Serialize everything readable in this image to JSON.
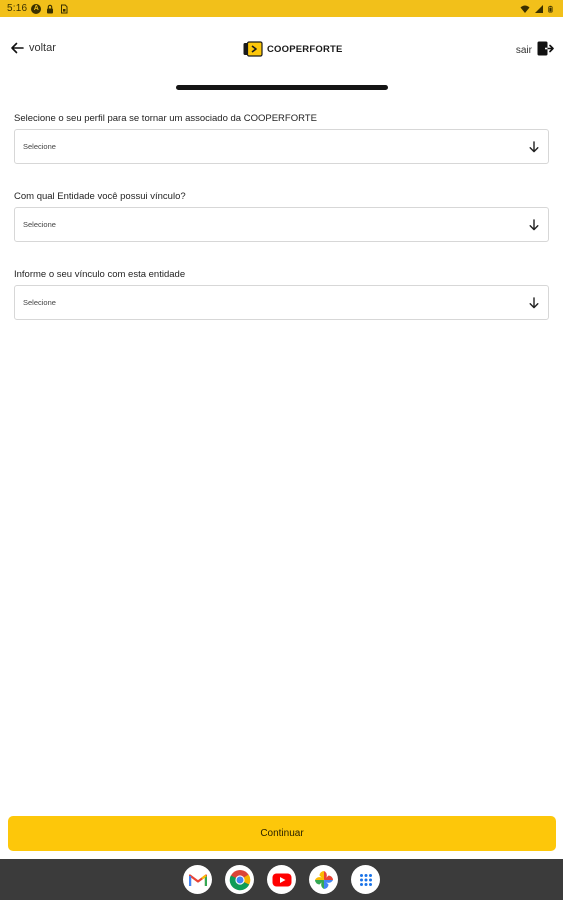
{
  "status_bar": {
    "time": "5:16",
    "badge_glyph": "A"
  },
  "header": {
    "back_label": "voltar",
    "logo_text": "COOPERFORTE",
    "exit_label": "sair"
  },
  "form": {
    "fields": [
      {
        "label": "Selecione o seu perfil para se tornar um associado da COOPERFORTE",
        "value": "Selecione"
      },
      {
        "label": "Com qual Entidade você possui vínculo?",
        "value": "Selecione"
      },
      {
        "label": "Informe o seu vínculo com esta entidade",
        "value": "Selecione"
      }
    ]
  },
  "actions": {
    "continue_label": "Continuar"
  },
  "dock": {
    "apps": [
      "gmail-icon",
      "chrome-icon",
      "youtube-icon",
      "photos-icon",
      "app-drawer-icon"
    ]
  },
  "colors": {
    "accent": "#fdc70a",
    "status_bar": "#f2c01a",
    "nav_bar": "#3b3b3b"
  }
}
